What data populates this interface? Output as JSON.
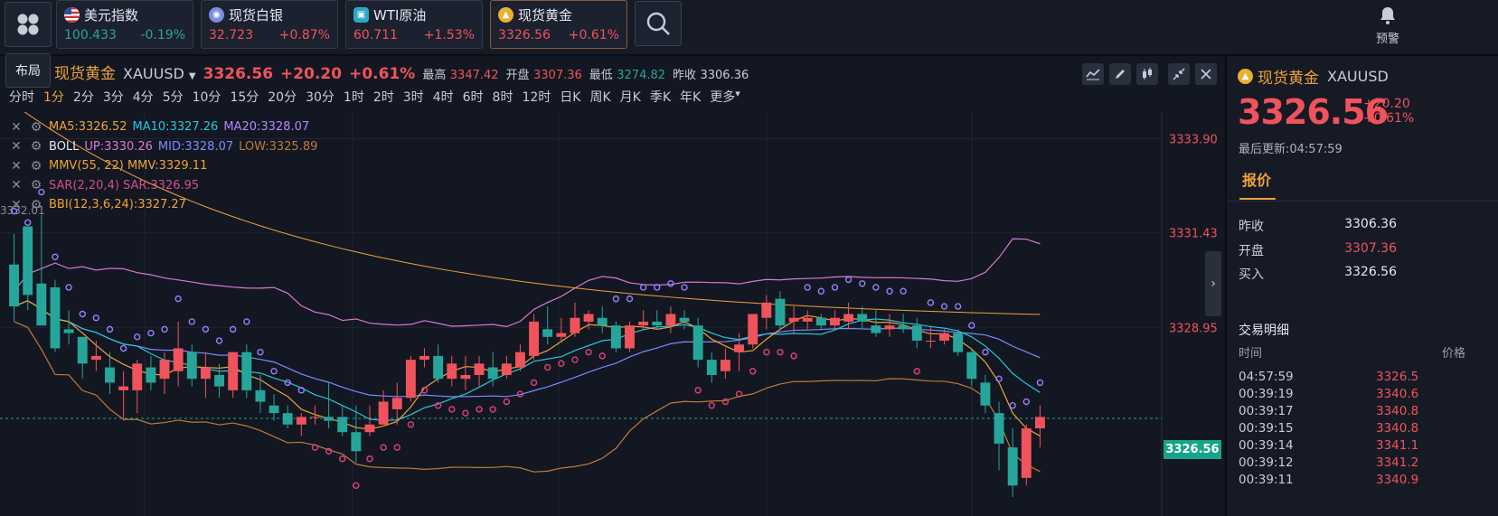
{
  "tickers": [
    {
      "name": "美元指数",
      "price": "100.433",
      "change": "-0.19%",
      "dir": "down",
      "icon": "us-flag-icon"
    },
    {
      "name": "现货白银",
      "price": "32.723",
      "change": "+0.87%",
      "dir": "up",
      "icon": "silver-coin-icon"
    },
    {
      "name": "WTI原油",
      "price": "60.711",
      "change": "+1.53%",
      "dir": "up",
      "icon": "oil-icon"
    },
    {
      "name": "现货黄金",
      "price": "3326.56",
      "change": "+0.61%",
      "dir": "up",
      "icon": "gold-coin-icon"
    }
  ],
  "alert_label": "预警",
  "layout_label": "布局",
  "header": {
    "name": "现货黄金",
    "code": "XAUUSD",
    "price": "3326.56",
    "change": "+20.20",
    "change_pct": "+0.61%",
    "high_label": "最高",
    "high": "3347.42",
    "open_label": "开盘",
    "open": "3307.36",
    "low_label": "最低",
    "low": "3274.82",
    "prev_label": "昨收",
    "prev": "3306.36"
  },
  "periods": [
    "分时",
    "1分",
    "2分",
    "3分",
    "4分",
    "5分",
    "10分",
    "15分",
    "20分",
    "30分",
    "1时",
    "2时",
    "3时",
    "4时",
    "6时",
    "8时",
    "12时",
    "日K",
    "周K",
    "月K",
    "季K",
    "年K",
    "更多"
  ],
  "active_period": "1分",
  "indicators": [
    {
      "parts": [
        [
          "MA5:3326.52",
          "#f0a23a"
        ],
        [
          "MA10:3327.26",
          "#26c6da"
        ],
        [
          "MA20:3328.07",
          "#b388ff"
        ]
      ]
    },
    {
      "parts": [
        [
          "BOLL",
          "#e6e8ee"
        ],
        [
          "UP:3330.26",
          "#d97ad6"
        ],
        [
          "MID:3328.07",
          "#7a8cff"
        ],
        [
          "LOW:3325.89",
          "#c07a3a"
        ]
      ]
    },
    {
      "parts": [
        [
          "MMV(55, 22) MMV:3329.11",
          "#f0a23a"
        ]
      ]
    },
    {
      "parts": [
        [
          "SAR(2,20,4) SAR:3326.95",
          "#d0508a"
        ]
      ]
    },
    {
      "parts": [
        [
          "BBI(12,3,6,24):3327.27",
          "#f0a23a"
        ]
      ]
    }
  ],
  "y_ticks": [
    "3333.90",
    "3331.43",
    "3328.95",
    "3326.56"
  ],
  "left_axis_label": "3332.01",
  "current_price_tag": "3326.56",
  "colors": {
    "up": "#f0535b",
    "down": "#26a69a",
    "accent": "#f0a23a"
  },
  "chart_data": {
    "type": "candlestick",
    "ylim": [
      3324.0,
      3334.6
    ],
    "candles": [
      [
        3330.6,
        3331.4,
        3329.1,
        3329.5
      ],
      [
        3331.6,
        3331.1,
        3329.4,
        3329.8
      ],
      [
        3330.1,
        3331.9,
        3329.0,
        3329.0
      ],
      [
        3330.0,
        3330.2,
        3328.3,
        3328.4
      ],
      [
        3328.9,
        3329.4,
        3328.5,
        3328.8
      ],
      [
        3328.7,
        3328.7,
        3327.6,
        3328.0
      ],
      [
        3328.1,
        3328.6,
        3327.8,
        3328.2
      ],
      [
        3327.9,
        3328.3,
        3327.2,
        3327.5
      ],
      [
        3327.3,
        3327.8,
        3326.5,
        3327.4
      ],
      [
        3327.3,
        3328.1,
        3326.7,
        3328.0
      ],
      [
        3327.9,
        3328.2,
        3327.3,
        3327.5
      ],
      [
        3327.6,
        3328.3,
        3327.2,
        3328.1
      ],
      [
        3327.8,
        3329.1,
        3327.4,
        3328.4
      ],
      [
        3328.3,
        3328.5,
        3327.4,
        3327.6
      ],
      [
        3327.6,
        3328.3,
        3327.1,
        3327.9
      ],
      [
        3327.7,
        3328.0,
        3327.1,
        3327.4
      ],
      [
        3327.3,
        3328.3,
        3327.1,
        3328.3
      ],
      [
        3328.3,
        3328.5,
        3327.1,
        3327.3
      ],
      [
        3327.3,
        3327.7,
        3326.7,
        3327.0
      ],
      [
        3326.9,
        3327.2,
        3326.5,
        3326.7
      ],
      [
        3326.7,
        3326.9,
        3326.3,
        3326.4
      ],
      [
        3326.4,
        3326.7,
        3326.1,
        3326.6
      ],
      [
        3326.6,
        3326.9,
        3326.4,
        3326.6
      ],
      [
        3326.6,
        3327.5,
        3326.3,
        3326.5
      ],
      [
        3326.6,
        3326.9,
        3326.1,
        3326.2
      ],
      [
        3326.2,
        3326.9,
        3325.4,
        3325.7
      ],
      [
        3326.2,
        3326.9,
        3326.1,
        3326.4
      ],
      [
        3326.4,
        3327.3,
        3326.4,
        3327.0
      ],
      [
        3326.8,
        3327.5,
        3326.4,
        3327.1
      ],
      [
        3327.1,
        3328.2,
        3327.0,
        3328.1
      ],
      [
        3328.1,
        3328.4,
        3327.9,
        3328.2
      ],
      [
        3328.2,
        3328.5,
        3327.5,
        3327.6
      ],
      [
        3327.6,
        3328.2,
        3327.4,
        3328.0
      ],
      [
        3327.6,
        3328.2,
        3327.3,
        3327.7
      ],
      [
        3327.7,
        3328.2,
        3327.4,
        3328.0
      ],
      [
        3327.9,
        3328.3,
        3327.4,
        3327.6
      ],
      [
        3327.7,
        3328.2,
        3327.6,
        3328.0
      ],
      [
        3327.9,
        3328.5,
        3327.8,
        3328.3
      ],
      [
        3328.2,
        3329.3,
        3328.1,
        3329.1
      ],
      [
        3328.9,
        3329.5,
        3328.5,
        3328.7
      ],
      [
        3328.7,
        3329.2,
        3328.6,
        3328.8
      ],
      [
        3328.8,
        3329.6,
        3328.7,
        3329.2
      ],
      [
        3329.1,
        3329.4,
        3328.9,
        3329.3
      ],
      [
        3329.2,
        3329.5,
        3328.8,
        3329.0
      ],
      [
        3329.0,
        3329.1,
        3328.3,
        3328.4
      ],
      [
        3328.4,
        3329.1,
        3328.3,
        3329.0
      ],
      [
        3329.0,
        3329.4,
        3328.9,
        3329.1
      ],
      [
        3329.1,
        3329.4,
        3328.9,
        3329.0
      ],
      [
        3329.0,
        3329.5,
        3328.8,
        3329.3
      ],
      [
        3329.2,
        3329.4,
        3328.9,
        3329.1
      ],
      [
        3329.0,
        3329.2,
        3327.9,
        3328.1
      ],
      [
        3328.1,
        3328.3,
        3327.5,
        3327.7
      ],
      [
        3327.8,
        3328.4,
        3327.6,
        3328.1
      ],
      [
        3328.3,
        3328.8,
        3327.8,
        3328.5
      ],
      [
        3328.5,
        3329.3,
        3328.4,
        3329.3
      ],
      [
        3329.2,
        3329.8,
        3328.9,
        3329.6
      ],
      [
        3329.7,
        3329.9,
        3328.9,
        3329.0
      ],
      [
        3329.1,
        3329.5,
        3328.8,
        3329.2
      ],
      [
        3329.1,
        3329.4,
        3328.9,
        3329.2
      ],
      [
        3329.2,
        3329.3,
        3328.9,
        3329.0
      ],
      [
        3329.0,
        3329.4,
        3328.9,
        3329.2
      ],
      [
        3329.1,
        3329.6,
        3328.9,
        3329.3
      ],
      [
        3329.3,
        3329.5,
        3328.9,
        3329.1
      ],
      [
        3329.0,
        3329.4,
        3328.7,
        3328.8
      ],
      [
        3328.9,
        3329.3,
        3328.7,
        3329.0
      ],
      [
        3329.0,
        3329.3,
        3328.8,
        3328.9
      ],
      [
        3329.0,
        3329.2,
        3328.4,
        3328.6
      ],
      [
        3328.6,
        3329.0,
        3328.4,
        3328.6
      ],
      [
        3328.6,
        3328.9,
        3328.5,
        3328.8
      ],
      [
        3328.8,
        3328.9,
        3328.2,
        3328.3
      ],
      [
        3328.3,
        3328.4,
        3327.4,
        3327.6
      ],
      [
        3327.5,
        3327.7,
        3326.7,
        3326.9
      ],
      [
        3326.7,
        3327.0,
        3325.2,
        3325.9
      ],
      [
        3325.8,
        3326.3,
        3324.5,
        3324.8
      ],
      [
        3325.0,
        3326.4,
        3324.8,
        3326.3
      ],
      [
        3326.3,
        3326.9,
        3325.8,
        3326.6
      ]
    ]
  },
  "side": {
    "name": "现货黄金",
    "code": "XAUUSD",
    "price": "3326.56",
    "change": "+20.20",
    "change_pct": "+0.61%",
    "updated": "最后更新:04:57:59",
    "tab": "报价",
    "rows": [
      {
        "k": "昨收",
        "v": "3306.36",
        "c": "#e6e8ee"
      },
      {
        "k": "开盘",
        "v": "3307.36",
        "c": "#f0535b"
      },
      {
        "k": "买入",
        "v": "3326.56",
        "c": "#e6e8ee"
      }
    ],
    "trades_title": "交易明细",
    "th_time": "时间",
    "th_price": "价格",
    "trades": [
      {
        "t": "04:57:59",
        "p": "3326.5"
      },
      {
        "t": "00:39:19",
        "p": "3340.6"
      },
      {
        "t": "00:39:17",
        "p": "3340.8"
      },
      {
        "t": "00:39:15",
        "p": "3340.8"
      },
      {
        "t": "00:39:14",
        "p": "3341.1"
      },
      {
        "t": "00:39:12",
        "p": "3341.2"
      },
      {
        "t": "00:39:11",
        "p": "3340.9"
      }
    ]
  }
}
